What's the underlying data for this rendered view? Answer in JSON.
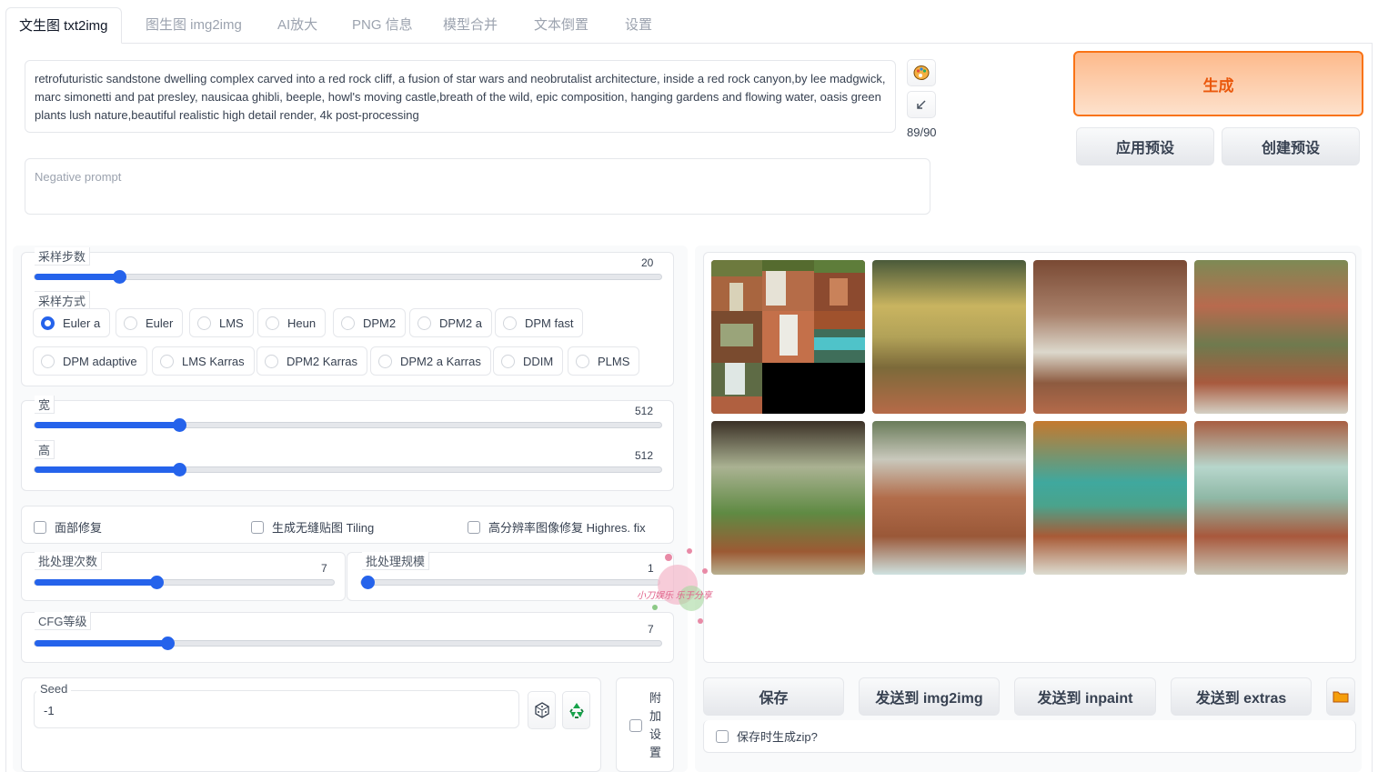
{
  "tabs": [
    "文生图 txt2img",
    "图生图 img2img",
    "AI放大",
    "PNG 信息",
    "模型合并",
    "文本倒置",
    "设置"
  ],
  "prompt": {
    "text": "retrofuturistic sandstone dwelling complex carved into a red rock cliff, a fusion of star wars and neobrutalist architecture, inside a red rock canyon,by lee madgwick, marc simonetti and pat presley, nausicaa ghibli, beeple, howl's moving castle,breath of the wild, epic composition, hanging gardens and flowing water, oasis green plants lush nature,beautiful realistic high detail render, 4k post-processing",
    "counter": "89/90",
    "negative_placeholder": "Negative prompt"
  },
  "buttons": {
    "generate": "生成",
    "apply_style": "应用预设",
    "create_style": "创建预设"
  },
  "sampling_steps": {
    "label": "采样步数",
    "value": "20",
    "fraction": 0.15
  },
  "sampler": {
    "label": "采样方式",
    "options": [
      "Euler a",
      "Euler",
      "LMS",
      "Heun",
      "DPM2",
      "DPM2 a",
      "DPM fast",
      "DPM adaptive",
      "LMS Karras",
      "DPM2 Karras",
      "DPM2 a Karras",
      "DDIM",
      "PLMS"
    ],
    "selected": "Euler a"
  },
  "width": {
    "label": "宽",
    "value": "512"
  },
  "height": {
    "label": "高",
    "value": "512"
  },
  "checks": {
    "face": "面部修复",
    "tiling": "生成无缝贴图 Tiling",
    "hires": "高分辨率图像修复 Highres. fix"
  },
  "batch_count": {
    "label": "批处理次数",
    "value": "7"
  },
  "batch_size": {
    "label": "批处理规模",
    "value": "1"
  },
  "cfg": {
    "label": "CFG等级",
    "value": "7"
  },
  "seed": {
    "label": "Seed",
    "value": "-1"
  },
  "extra": {
    "label": "附加设置",
    "chars": [
      "附",
      "加",
      "设",
      "置"
    ]
  },
  "output_buttons": {
    "save": "保存",
    "img2img": "发送到 img2img",
    "inpaint": "发送到 inpaint",
    "extras": "发送到 extras"
  },
  "zip_label": "保存时生成zip?",
  "watermark": "小刀娱乐 乐于分享",
  "icons": {
    "style": "palette-icon",
    "arrow": "arrow-icon",
    "dice": "dice-icon",
    "recycle": "recycle-icon",
    "folder": "folder-icon"
  }
}
